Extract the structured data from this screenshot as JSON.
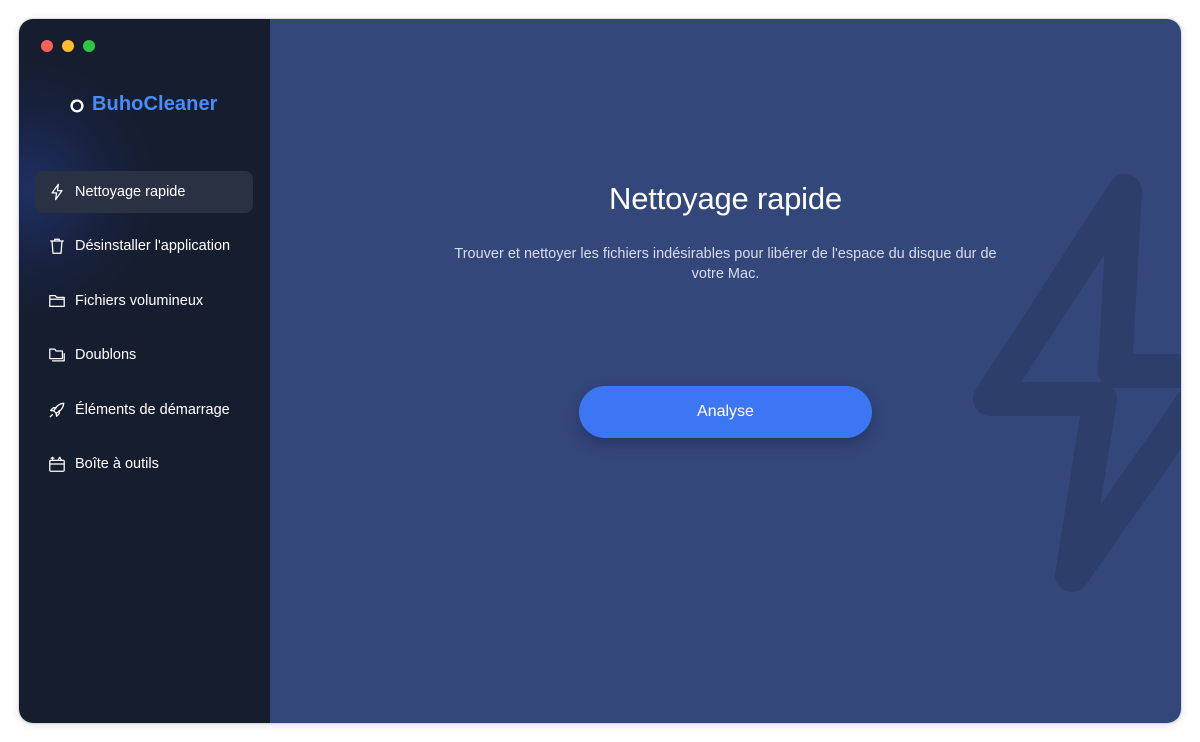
{
  "app": {
    "name": "BuhoCleaner",
    "brand_color": "#4a8cf7",
    "window_controls": [
      "close",
      "minimize",
      "maximize"
    ]
  },
  "sidebar": {
    "items": [
      {
        "label": "Nettoyage rapide",
        "icon": "lightning-icon",
        "active": true
      },
      {
        "label": "Désinstaller l'application",
        "icon": "trash-icon",
        "active": false
      },
      {
        "label": "Fichiers volumineux",
        "icon": "folder-icon",
        "active": false
      },
      {
        "label": "Doublons",
        "icon": "duplicate-folder-icon",
        "active": false
      },
      {
        "label": "Éléments de démarrage",
        "icon": "rocket-icon",
        "active": false
      },
      {
        "label": "Boîte à outils",
        "icon": "toolbox-icon",
        "active": false
      }
    ]
  },
  "main": {
    "title": "Nettoyage rapide",
    "description": "Trouver et nettoyer les fichiers indésirables pour libérer de l'espace du disque dur de votre Mac.",
    "button_label": "Analyse",
    "background_icon": "lightning-icon",
    "accent_color": "#3d76f2",
    "background_color": "#34477a"
  }
}
